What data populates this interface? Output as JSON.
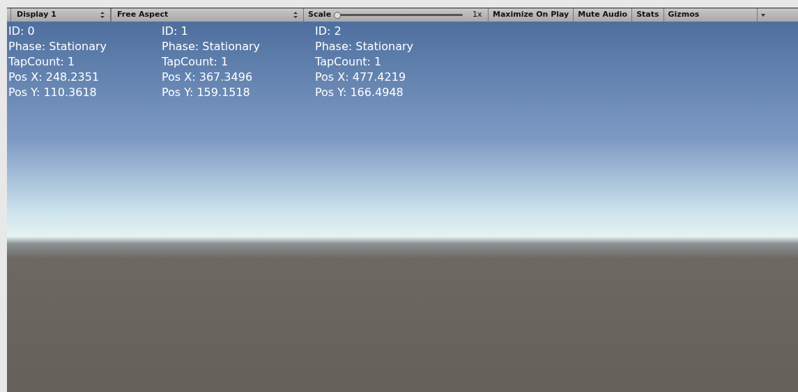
{
  "toolbar": {
    "display": "Display 1",
    "aspect": "Free Aspect",
    "scale": {
      "label": "Scale",
      "level": 0,
      "reading": "1x"
    },
    "buttons": [
      "Maximize On Play",
      "Mute Audio",
      "Stats",
      "Gizmos"
    ]
  },
  "touches": [
    {
      "id": "ID: 0",
      "phase": "Phase: Stationary",
      "tap_count": "TapCount: 1",
      "pos_x": "Pos X: 248.2351",
      "pos_y": "Pos Y: 110.3618"
    },
    {
      "id": "ID: 1",
      "phase": "Phase: Stationary",
      "tap_count": "TapCount: 1",
      "pos_x": "Pos X: 367.3496",
      "pos_y": "Pos Y: 159.1518"
    },
    {
      "id": "ID: 2",
      "phase": "Phase: Stationary",
      "tap_count": "TapCount: 1",
      "pos_x": "Pos X: 477.4219",
      "pos_y": "Pos Y: 166.4948"
    }
  ]
}
